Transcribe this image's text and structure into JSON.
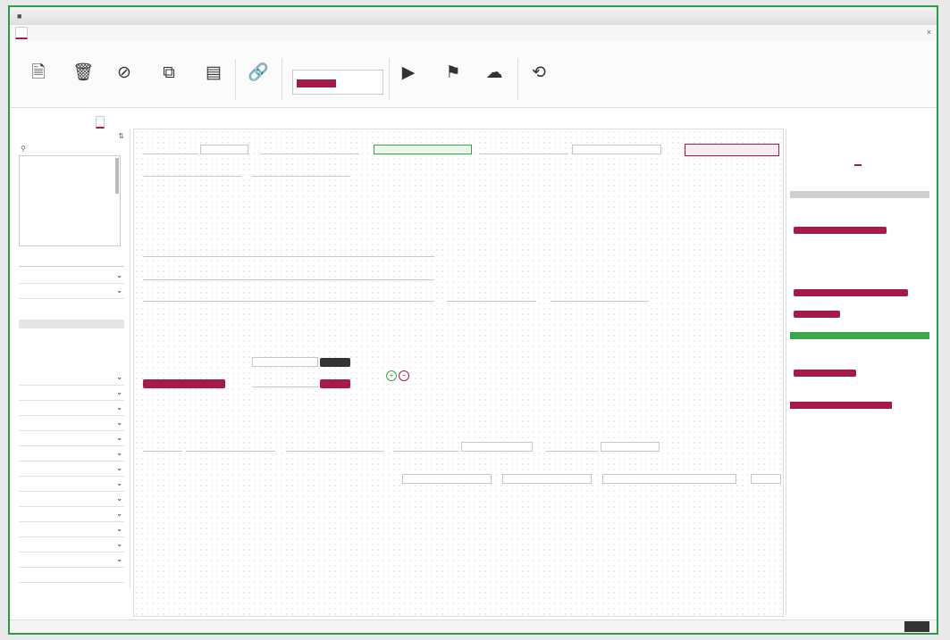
{
  "colors": {
    "accent": "#a51a4b",
    "frame_green": "#2e9a4a",
    "ok_green": "#3aa648"
  },
  "window": {
    "app_icon": "app-icon",
    "title": "",
    "controls": ""
  },
  "menu": {
    "items": [
      {
        "label": ""
      },
      {
        "label": ""
      },
      {
        "label": ""
      },
      {
        "label": ""
      }
    ],
    "close_icon": "close-icon"
  },
  "ribbon": {
    "groups": [
      {
        "label": ""
      },
      {
        "label": ""
      },
      {
        "label": ""
      },
      {
        "label": ""
      }
    ],
    "buttons": [
      {
        "icon": "new-document-icon",
        "label": ""
      },
      {
        "icon": "save-icon",
        "label": ""
      },
      {
        "icon": "cancel-icon",
        "label": ""
      },
      {
        "icon": "copy-icon",
        "label": ""
      },
      {
        "icon": "clipboard-icon",
        "label": ""
      },
      {
        "icon": "link-icon",
        "label": ""
      },
      {
        "icon": "play-icon",
        "label": ""
      },
      {
        "icon": "flag-icon",
        "label": ""
      },
      {
        "icon": "upload-cloud-icon",
        "label": ""
      },
      {
        "icon": "undo-icon",
        "label": ""
      }
    ],
    "status": {
      "label": "",
      "value": ""
    }
  },
  "subtabs": [
    {
      "label": ""
    },
    {
      "label": ""
    },
    {
      "label": ""
    },
    {
      "label": ""
    }
  ],
  "left_panel": {
    "title": "",
    "tree_label": "",
    "search_placeholder": "",
    "sections": [
      {
        "label": ""
      },
      {
        "label": ""
      }
    ],
    "filter_value": "",
    "options": [
      {
        "label": ""
      },
      {
        "label": ""
      },
      {
        "label": ""
      },
      {
        "label": ""
      }
    ],
    "sections2": [
      {
        "label": ""
      },
      {
        "label": ""
      },
      {
        "label": ""
      },
      {
        "label": ""
      },
      {
        "label": ""
      },
      {
        "label": ""
      },
      {
        "label": ""
      },
      {
        "label": ""
      },
      {
        "label": ""
      },
      {
        "label": ""
      },
      {
        "label": ""
      },
      {
        "label": ""
      },
      {
        "label": ""
      },
      {
        "label": ""
      }
    ]
  },
  "form": {
    "row1": [
      {
        "label": ""
      },
      {
        "label": ""
      },
      {
        "label": ""
      },
      {
        "label": ""
      },
      {
        "label": ""
      }
    ],
    "row2": [
      {
        "label": ""
      },
      {
        "label": ""
      }
    ],
    "sections": [
      {
        "label": ""
      },
      {
        "label": ""
      },
      {
        "label": ""
      }
    ],
    "s1_fields": [
      {
        "label": ""
      },
      {
        "label": ""
      },
      {
        "label": ""
      },
      {
        "label": ""
      },
      {
        "label": ""
      }
    ],
    "s2_fields": [
      {
        "label": ""
      },
      {
        "label": ""
      },
      {
        "label": ""
      }
    ],
    "s3_fields": [
      {
        "label": ""
      },
      {
        "label": ""
      },
      {
        "label": ""
      },
      {
        "label": ""
      },
      {
        "label": ""
      },
      {
        "label": ""
      },
      {
        "label": ""
      },
      {
        "label": ""
      },
      {
        "label": ""
      }
    ]
  },
  "right_panel": {
    "title": "",
    "controls": "",
    "tabs": [
      {
        "label": ""
      },
      {
        "label": ""
      }
    ],
    "heading": "",
    "items": [
      {
        "label": ""
      },
      {
        "label": ""
      },
      {
        "label": ""
      },
      {
        "label": ""
      },
      {
        "label": ""
      },
      {
        "label": ""
      },
      {
        "label": ""
      }
    ]
  },
  "statusbar": {
    "items": [
      {
        "label": ""
      },
      {
        "label": ""
      },
      {
        "label": ""
      }
    ]
  }
}
